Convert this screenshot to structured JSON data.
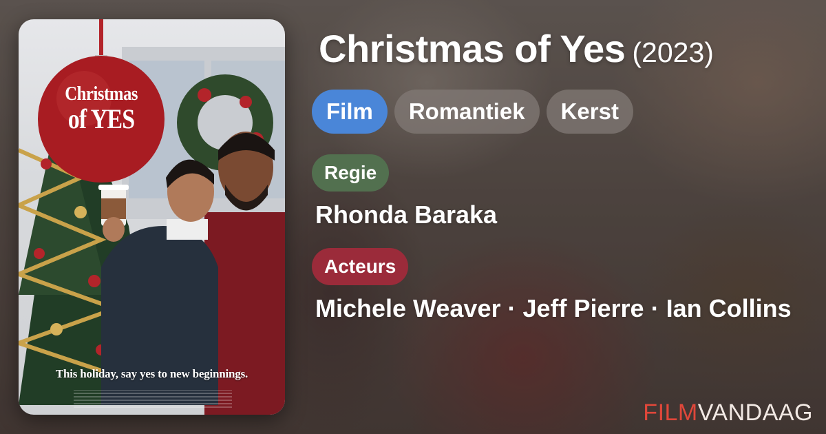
{
  "film": {
    "title": "Christmas of Yes",
    "year": "(2023)"
  },
  "tags": [
    {
      "label": "Film",
      "active": true
    },
    {
      "label": "Romantiek",
      "active": false
    },
    {
      "label": "Kerst",
      "active": false
    }
  ],
  "director": {
    "label": "Regie",
    "name": "Rhonda Baraka"
  },
  "cast": {
    "label": "Acteurs",
    "names": [
      "Michele Weaver",
      "Jeff Pierre",
      "Ian Collins"
    ],
    "separator": "·"
  },
  "poster": {
    "title_line1": "Christmas",
    "title_line2": "of YES",
    "tagline": "This holiday, say yes to new beginnings."
  },
  "brand": {
    "part1": "FILM",
    "part2": "VANDAAG"
  },
  "colors": {
    "tag_active": "#4a86d8",
    "regie_label": "#52704f",
    "acteurs_label": "#9b2b3a",
    "brand_accent": "#e0473a"
  }
}
